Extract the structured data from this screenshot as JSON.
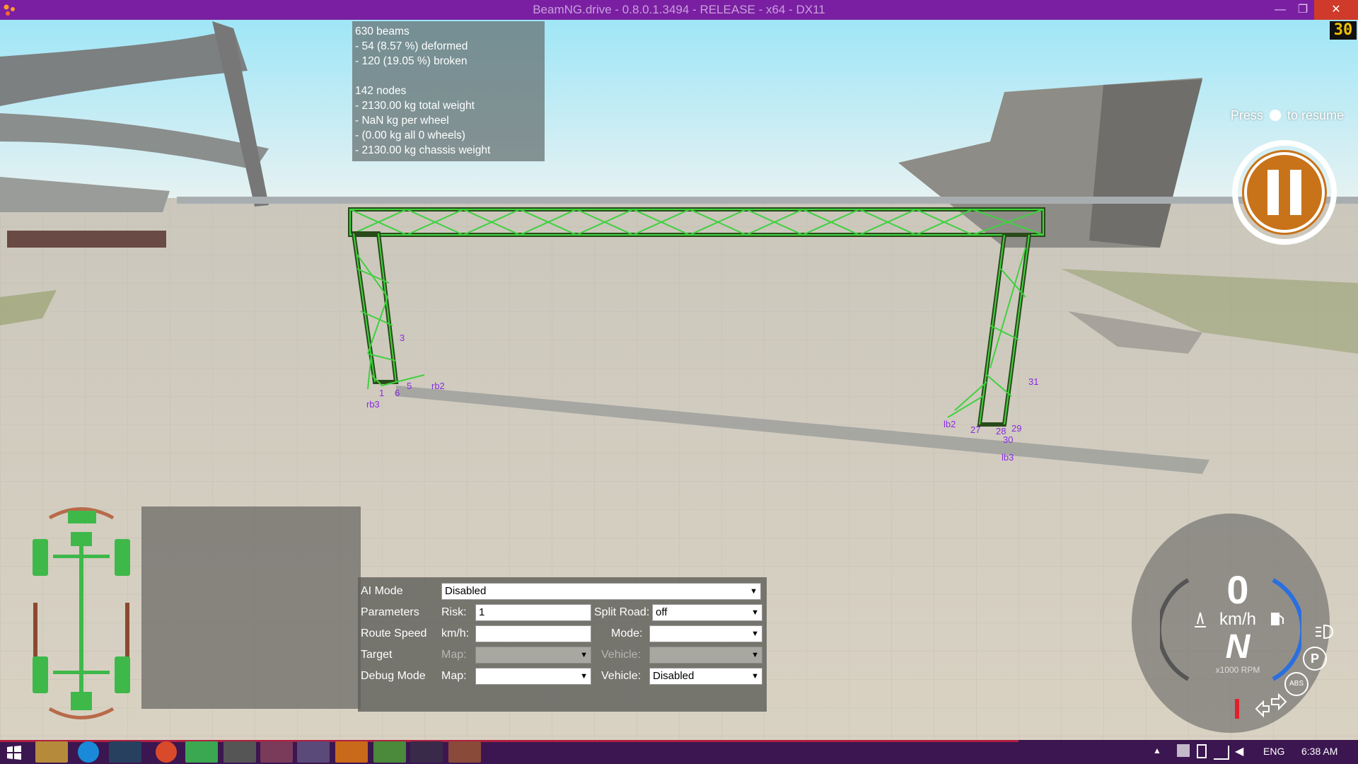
{
  "window": {
    "title": "BeamNG.drive - 0.8.0.1.3494 - RELEASE - x64 - DX11",
    "minimize_glyph": "—",
    "restore_glyph": "❐",
    "close_glyph": "✕"
  },
  "fps_counter": "30",
  "beam_info": {
    "lines": [
      "630 beams",
      "- 54 (8.57 %) deformed",
      "- 120 (19.05 %) broken",
      "",
      "142 nodes",
      "- 2130.00 kg total weight",
      "- NaN kg per wheel",
      "- (0.00 kg all 0 wheels)",
      "- 2130.00 kg chassis weight"
    ]
  },
  "resume_hint": {
    "press": "Press",
    "suffix": "to resume",
    "icon": "menu-icon"
  },
  "node_labels": [
    "rb3",
    "rb2",
    "1",
    "6",
    "5",
    "3",
    "lb2",
    "lb3",
    "27",
    "28",
    "29",
    "30",
    "31"
  ],
  "ai_panel": {
    "rows": [
      {
        "label": "AI Mode"
      },
      {
        "label": "Parameters"
      },
      {
        "label": "Route Speed"
      },
      {
        "label": "Target"
      },
      {
        "label": "Debug Mode"
      }
    ],
    "ai_mode_value": "Disabled",
    "risk_label": "Risk:",
    "risk_value": "1",
    "split_road_label": "Split Road:",
    "split_road_value": "off",
    "kmh_label": "km/h:",
    "kmh_value": "",
    "mode_label": "Mode:",
    "mode_value": "",
    "target_map_label": "Map:",
    "target_vehicle_label": "Vehicle:",
    "debug_map_label": "Map:",
    "debug_map_value": "",
    "debug_vehicle_label": "Vehicle:",
    "debug_vehicle_value": "Disabled"
  },
  "gauge": {
    "speed": "0",
    "speed_unit": "km/h",
    "gear": "N",
    "rpm_label": "x1000 RPM",
    "parking_icon": "P",
    "abs_icon": "ABS"
  },
  "tray": {
    "language": "ENG",
    "time": "6:38 AM"
  },
  "colors": {
    "titlebar": "#7a1fa2",
    "taskbar": "#3b1650",
    "truss_green": "#3fd13f",
    "node_label": "#8a2be2",
    "pause_ring": "#ffffff",
    "gauge_blue": "#2a6fe0"
  }
}
